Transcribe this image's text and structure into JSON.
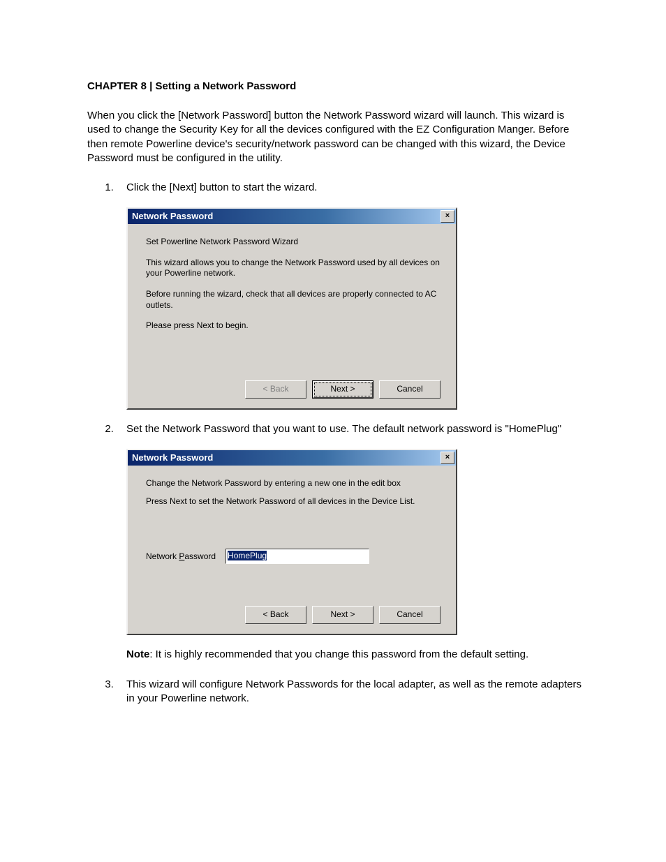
{
  "chapter_title": "CHAPTER 8 | Setting a Network Password",
  "intro": "When you click the [Network Password] button the Network Password wizard will launch. This wizard is used to change the Security Key for all the devices configured with the EZ Configuration Manger. Before then remote Powerline device's security/network password can be changed with this wizard, the Device Password must be configured in the utility.",
  "step1": "Click the [Next] button to start the wizard.",
  "dialog1": {
    "title": "Network Password",
    "close": "×",
    "p1": "Set Powerline Network Password Wizard",
    "p2": "This wizard allows you to change the Network Password used by all devices on your Powerline network.",
    "p3": "Before running the wizard, check that all devices are properly connected to AC outlets.",
    "p4": "Please press Next to begin.",
    "back": "< Back",
    "next": "Next >",
    "cancel": "Cancel"
  },
  "step2": "Set the Network Password that you want to use.  The default network password is \"HomePlug\"",
  "dialog2": {
    "title": "Network Password",
    "close": "×",
    "p1": "Change the Network Password by entering a new one in the edit box",
    "p2": "Press Next to set the Network Password of all devices in the Device List.",
    "input_label_a": "Network ",
    "input_label_u": "P",
    "input_label_b": "assword",
    "input_value": "HomePlug",
    "back": "< Back",
    "next": "Next >",
    "cancel": "Cancel"
  },
  "note_bold": "Note",
  "note_rest": ": It is highly recommended that you change this password from the default setting.",
  "step3": "This wizard will configure Network Passwords for the local adapter, as well as the remote adapters in your Powerline network."
}
